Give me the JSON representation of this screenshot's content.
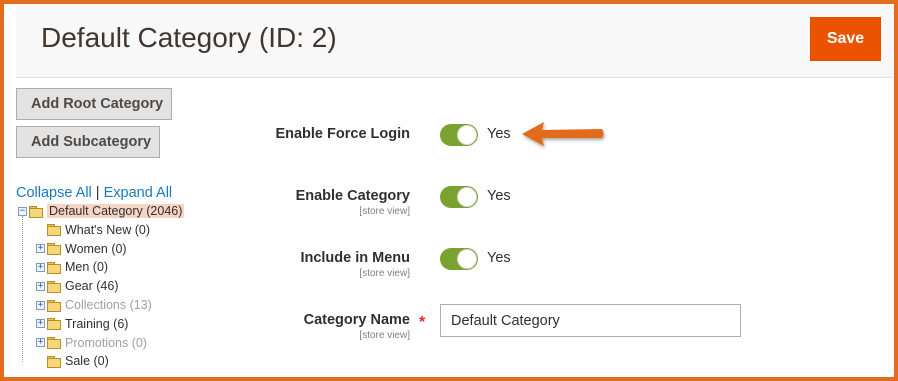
{
  "header": {
    "title": "Default Category (ID: 2)",
    "save_label": "Save"
  },
  "buttons": {
    "add_root": "Add Root Category",
    "add_sub": "Add Subcategory"
  },
  "tree": {
    "collapse_all": "Collapse All",
    "separator": "|",
    "expand_all": "Expand All",
    "items": [
      {
        "label": "Default Category (2046)",
        "level": 0,
        "expander": "minus",
        "enabled": true,
        "selected": true
      },
      {
        "label": "What's New (0)",
        "level": 1,
        "expander": "none",
        "enabled": true
      },
      {
        "label": "Women (0)",
        "level": 1,
        "expander": "plus",
        "enabled": true
      },
      {
        "label": "Men (0)",
        "level": 1,
        "expander": "plus",
        "enabled": true
      },
      {
        "label": "Gear (46)",
        "level": 1,
        "expander": "plus",
        "enabled": true
      },
      {
        "label": "Collections (13)",
        "level": 1,
        "expander": "plus",
        "enabled": false
      },
      {
        "label": "Training (6)",
        "level": 1,
        "expander": "plus",
        "enabled": true
      },
      {
        "label": "Promotions (0)",
        "level": 1,
        "expander": "plus",
        "enabled": false
      },
      {
        "label": "Sale (0)",
        "level": 1,
        "expander": "none",
        "enabled": true
      }
    ]
  },
  "form": {
    "enable_force_login": {
      "label": "Enable Force Login",
      "value": "Yes",
      "on": true
    },
    "enable_category": {
      "label": "Enable Category",
      "scope": "[store view]",
      "value": "Yes",
      "on": true
    },
    "include_in_menu": {
      "label": "Include in Menu",
      "scope": "[store view]",
      "value": "Yes",
      "on": true
    },
    "category_name": {
      "label": "Category Name",
      "scope": "[store view]",
      "required_mark": "*",
      "value": "Default Category"
    }
  },
  "annotation": {
    "icon": "arrow-left-icon",
    "color": "#e36c1f"
  },
  "colors": {
    "accent": "#eb5202",
    "toggle_on": "#79a22e",
    "link": "#1979c3",
    "frame": "#e36c1f"
  }
}
